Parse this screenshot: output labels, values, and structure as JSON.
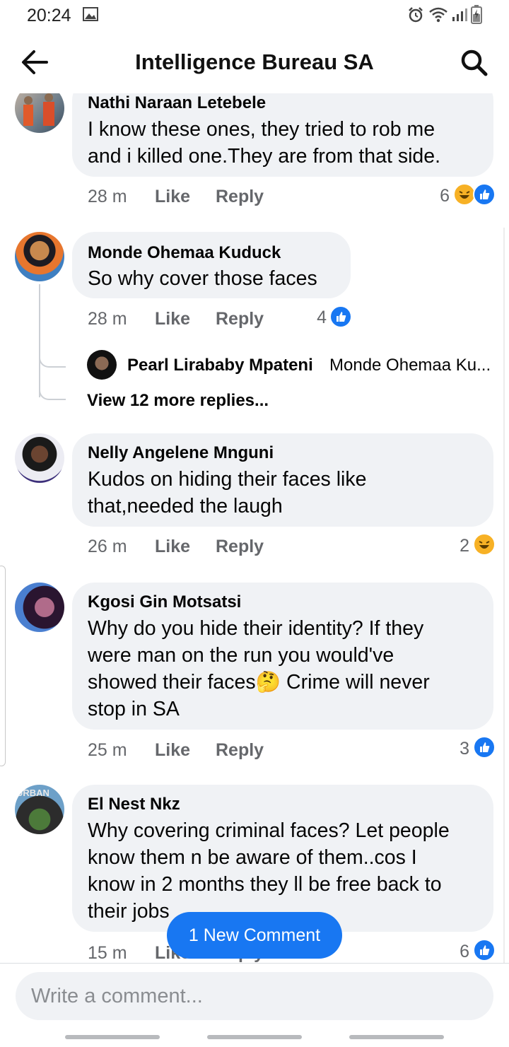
{
  "status_bar": {
    "time": "20:24"
  },
  "header": {
    "title": "Intelligence Bureau SA"
  },
  "comments": [
    {
      "name": "Nathi Naraan Letebele",
      "lines": [
        "I know these ones, they tried to rob me",
        "and i killed one.They are from that side."
      ],
      "time": "28 m",
      "like": "Like",
      "reply": "Reply",
      "reaction_count": "6",
      "reactions": [
        "haha-icon",
        "like-icon"
      ]
    },
    {
      "name": "Monde Ohemaa Kuduck",
      "lines": [
        "So why cover those faces"
      ],
      "time": "28 m",
      "like": "Like",
      "reply": "Reply",
      "reaction_count": "4",
      "reactions": [
        "like-icon"
      ],
      "reply_preview": {
        "name": "Pearl Lirababy Mpateni",
        "text": "Monde Ohemaa Ku..."
      },
      "view_more": "View 12 more replies..."
    },
    {
      "name": "Nelly Angelene Mnguni",
      "lines": [
        "Kudos on hiding their faces like",
        "that,needed the laugh"
      ],
      "time": "26 m",
      "like": "Like",
      "reply": "Reply",
      "reaction_count": "2",
      "reactions": [
        "haha-icon"
      ]
    },
    {
      "name": "Kgosi Gin Motsatsi",
      "lines": [
        "Why do you hide their identity? If they",
        "were man on the run you would've",
        "showed their faces🤔 Crime will never",
        "stop in SA"
      ],
      "time": "25 m",
      "like": "Like",
      "reply": "Reply",
      "reaction_count": "3",
      "reactions": [
        "like-icon"
      ]
    },
    {
      "name": "El Nest Nkz",
      "lines": [
        "Why covering criminal faces? Let people",
        "know them n be aware of them..cos I",
        "know in 2 months they ll be free back to",
        "their jobs"
      ],
      "time": "15 m",
      "like": "Like",
      "reply": "Reply",
      "reaction_count": "6",
      "reactions": [
        "like-icon"
      ],
      "avatar_text": "URBAN"
    }
  ],
  "new_comment_button": "1 New Comment",
  "composer": {
    "placeholder": "Write a comment..."
  },
  "colors": {
    "accent": "#1877f2",
    "bubble": "#f0f2f5",
    "meta": "#65676b",
    "haha": "#f7b125"
  }
}
